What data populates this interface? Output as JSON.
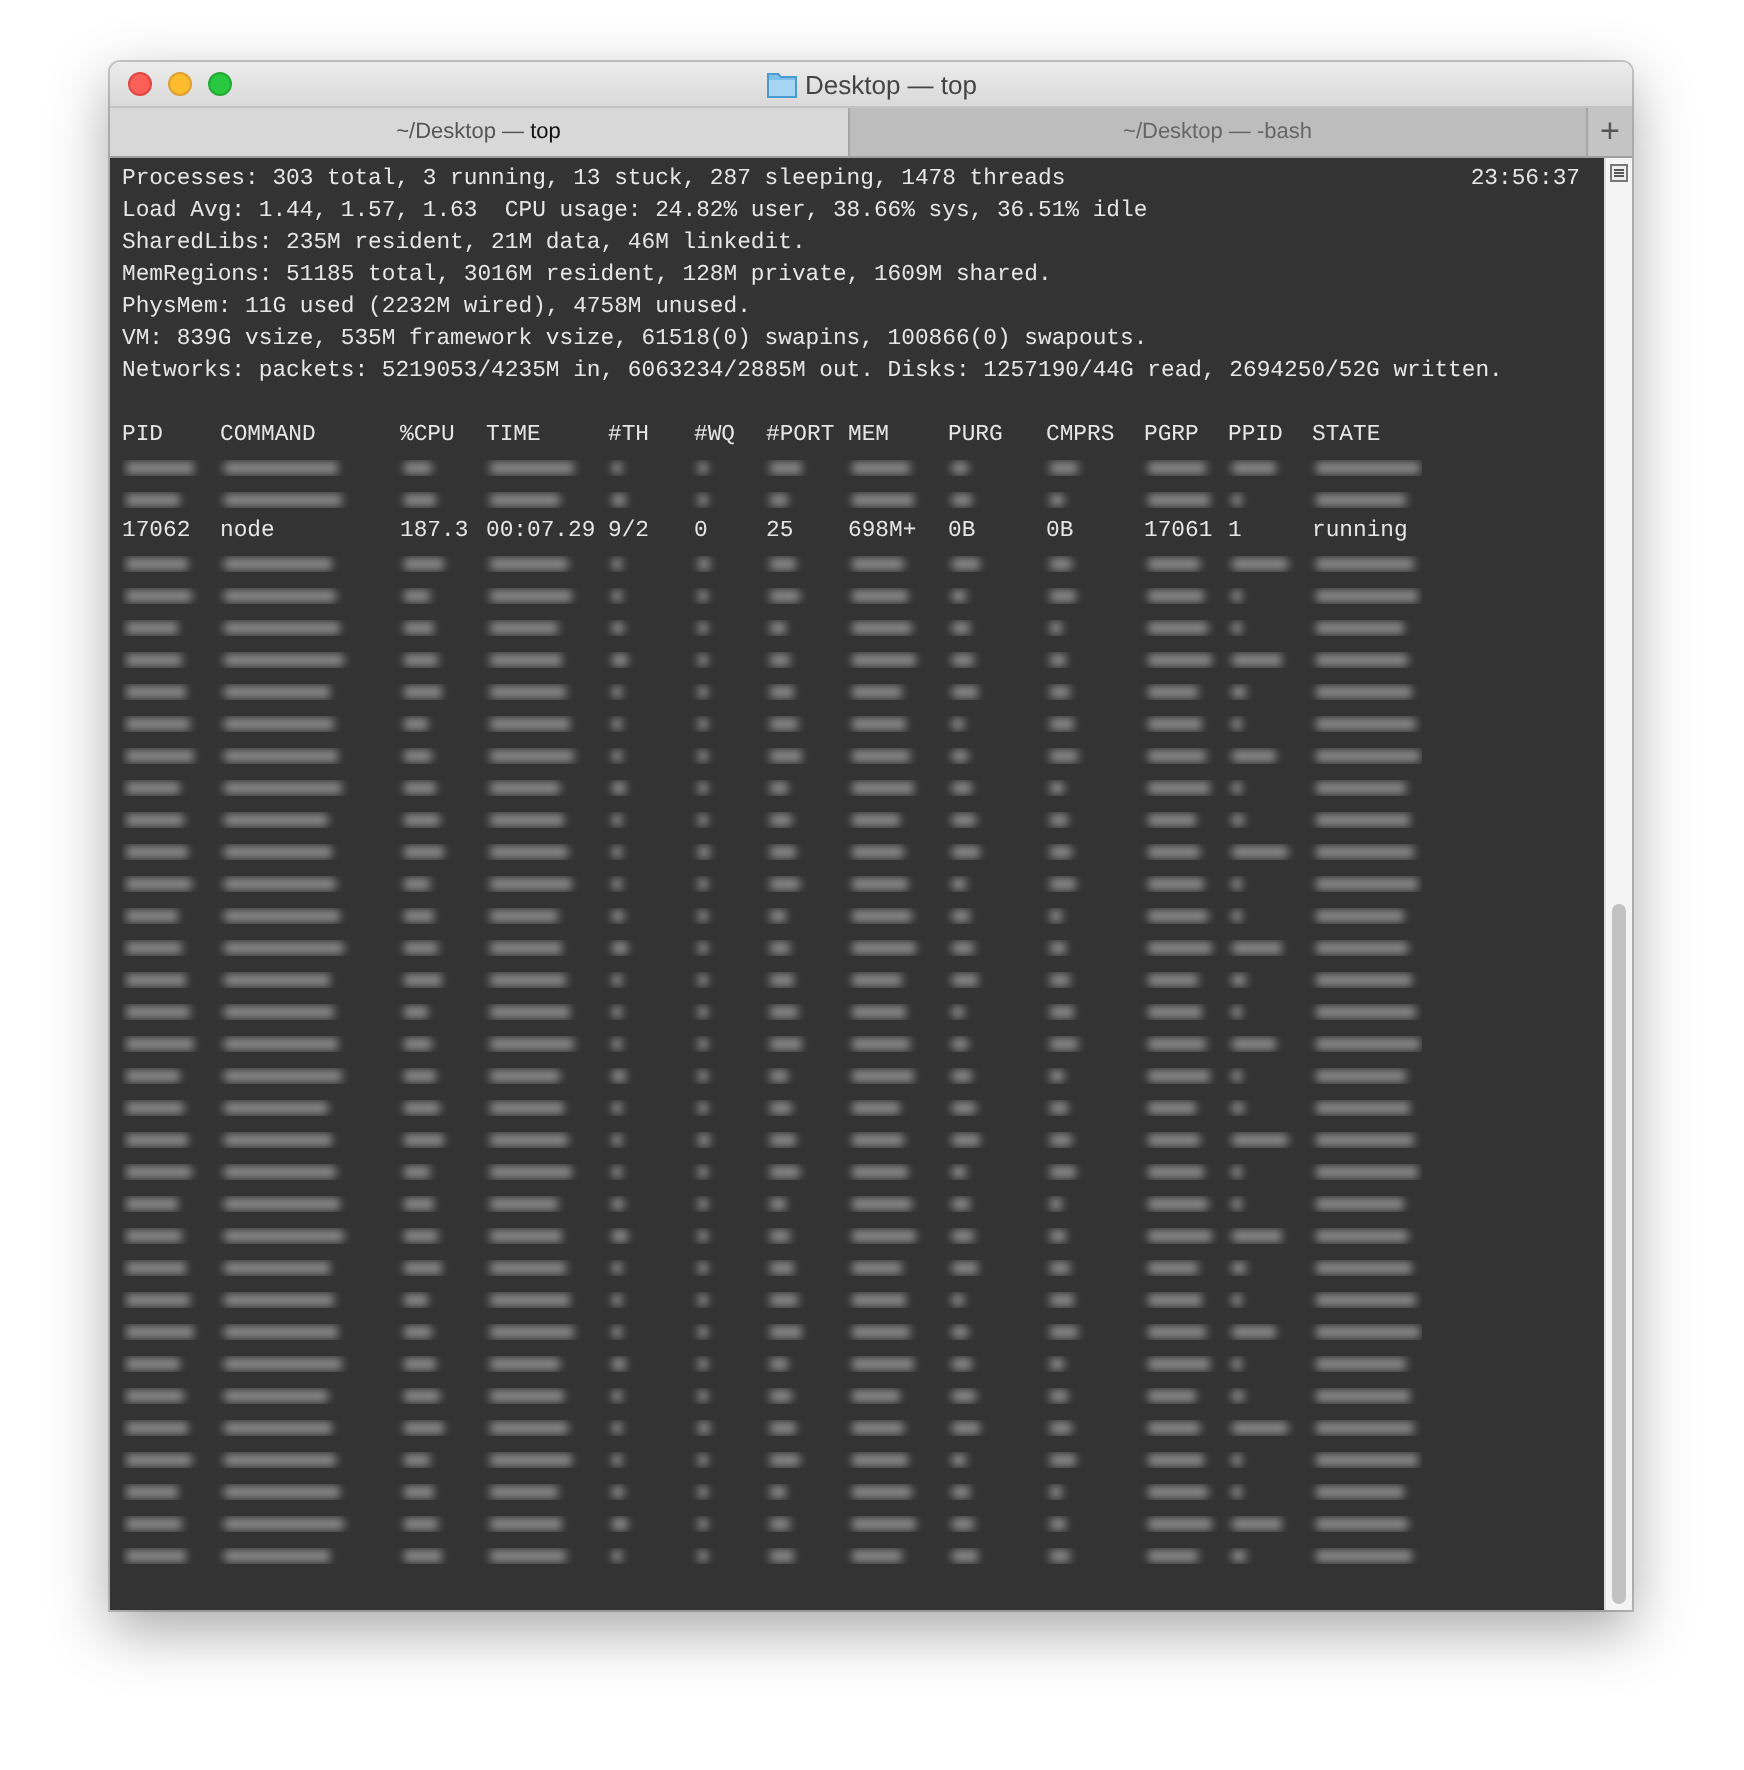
{
  "window": {
    "title": "Desktop — top"
  },
  "tabs": [
    {
      "label": "~/Desktop — **top**",
      "selected": true
    },
    {
      "label": "~/Desktop — -bash",
      "selected": false
    }
  ],
  "new_tab_button": "+",
  "summary": {
    "lines": [
      "Processes: 303 total, 3 running, 13 stuck, 287 sleeping, 1478 threads",
      "Load Avg: 1.44, 1.57, 1.63  CPU usage: 24.82% user, 38.66% sys, 36.51% idle",
      "SharedLibs: 235M resident, 21M data, 46M linkedit.",
      "MemRegions: 51185 total, 3016M resident, 128M private, 1609M shared.",
      "PhysMem: 11G used (2232M wired), 4758M unused.",
      "VM: 839G vsize, 535M framework vsize, 61518(0) swapins, 100866(0) swapouts.",
      "Networks: packets: 5219053/4235M in, 6063234/2885M out. Disks: 1257190/44G read, 2694250/52G written."
    ],
    "clock": "23:56:37"
  },
  "table": {
    "columns": [
      "PID",
      "COMMAND",
      "%CPU",
      "TIME",
      "#TH",
      "#WQ",
      "#PORT",
      "MEM",
      "PURG",
      "CMPRS",
      "PGRP",
      "PPID",
      "STATE"
    ],
    "rows": [
      {
        "kind": "blurred"
      },
      {
        "kind": "blurred"
      },
      {
        "kind": "process",
        "cells": [
          "17062",
          "node",
          "187.3",
          "00:07.29",
          "9/2",
          "0",
          "25",
          "698M+",
          "0B",
          "0B",
          "17061",
          "1",
          "running"
        ]
      },
      {
        "kind": "blurred"
      },
      {
        "kind": "blurred"
      },
      {
        "kind": "blurred"
      },
      {
        "kind": "blurred"
      },
      {
        "kind": "blurred"
      },
      {
        "kind": "blurred"
      },
      {
        "kind": "blurred"
      },
      {
        "kind": "blurred"
      },
      {
        "kind": "blurred"
      },
      {
        "kind": "blurred"
      },
      {
        "kind": "blurred"
      },
      {
        "kind": "blurred"
      },
      {
        "kind": "blurred"
      },
      {
        "kind": "blurred"
      },
      {
        "kind": "blurred"
      },
      {
        "kind": "blurred"
      },
      {
        "kind": "blurred"
      },
      {
        "kind": "blurred"
      },
      {
        "kind": "blurred"
      },
      {
        "kind": "blurred"
      },
      {
        "kind": "blurred"
      },
      {
        "kind": "blurred"
      },
      {
        "kind": "blurred"
      },
      {
        "kind": "blurred"
      },
      {
        "kind": "blurred"
      },
      {
        "kind": "blurred"
      },
      {
        "kind": "blurred"
      },
      {
        "kind": "blurred"
      },
      {
        "kind": "blurred"
      },
      {
        "kind": "blurred"
      },
      {
        "kind": "blurred"
      },
      {
        "kind": "blurred"
      }
    ]
  }
}
